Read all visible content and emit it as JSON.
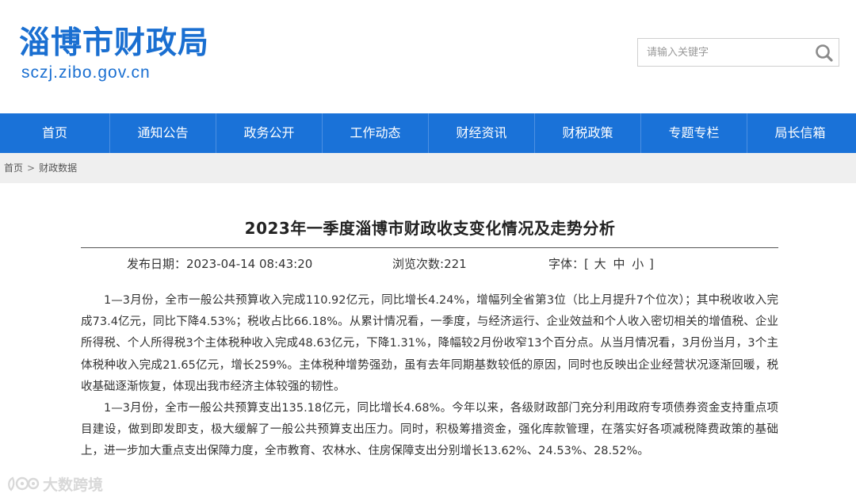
{
  "site": {
    "name_cn": "淄博市财政局",
    "url": "sczj.zibo.gov.cn"
  },
  "search": {
    "placeholder": "请输入关键字"
  },
  "nav": {
    "items": [
      {
        "label": "首页"
      },
      {
        "label": "通知公告"
      },
      {
        "label": "政务公开"
      },
      {
        "label": "工作动态"
      },
      {
        "label": "财经资讯"
      },
      {
        "label": "财税政策"
      },
      {
        "label": "专题专栏"
      },
      {
        "label": "局长信箱"
      }
    ]
  },
  "breadcrumb": {
    "home": "首页",
    "separator": ">",
    "current": "财政数据"
  },
  "article": {
    "title": "2023年一季度淄博市财政收支变化情况及走势分析",
    "publish_label": "发布日期：",
    "publish_date": "2023-04-14 08:43:20",
    "views_label": "浏览次数:",
    "views": "221",
    "font_label": "字体：[",
    "font_large": "大",
    "font_medium": "中",
    "font_small": "小",
    "font_close": "]",
    "paragraphs": [
      "1—3月份，全市一般公共预算收入完成110.92亿元，同比增长4.24%，增幅列全省第3位（比上月提升7个位次）；其中税收收入完成73.4亿元，同比下降4.53%；税收占比66.18%。从累计情况看，一季度，与经济运行、企业效益和个人收入密切相关的增值税、企业所得税、个人所得税3个主体税种收入完成48.63亿元，下降1.31%，降幅较2月份收窄13个百分点。从当月情况看，3月份当月，3个主体税种收入完成21.65亿元，增长259%。主体税种增势强劲，虽有去年同期基数较低的原因，同时也反映出企业经营状况逐渐回暖，税收基础逐渐恢复，体现出我市经济主体较强的韧性。",
      "1—3月份，全市一般公共预算支出135.18亿元，同比增长4.68%。今年以来，各级财政部门充分利用政府专项债券资金支持重点项目建设，做到即发即支，极大缓解了一般公共预算支出压力。同时，积极筹措资金，强化库款管理，在落实好各项减税降费政策的基础上，进一步加大重点支出保障力度，全市教育、农林水、住房保障支出分别增长13.62%、24.53%、28.52%。"
    ]
  },
  "watermark": {
    "text": "大数跨境"
  },
  "colors": {
    "brand_blue": "#1a72d8",
    "logo_blue": "#1a6fd1",
    "breadcrumb_bg": "#efefef"
  }
}
